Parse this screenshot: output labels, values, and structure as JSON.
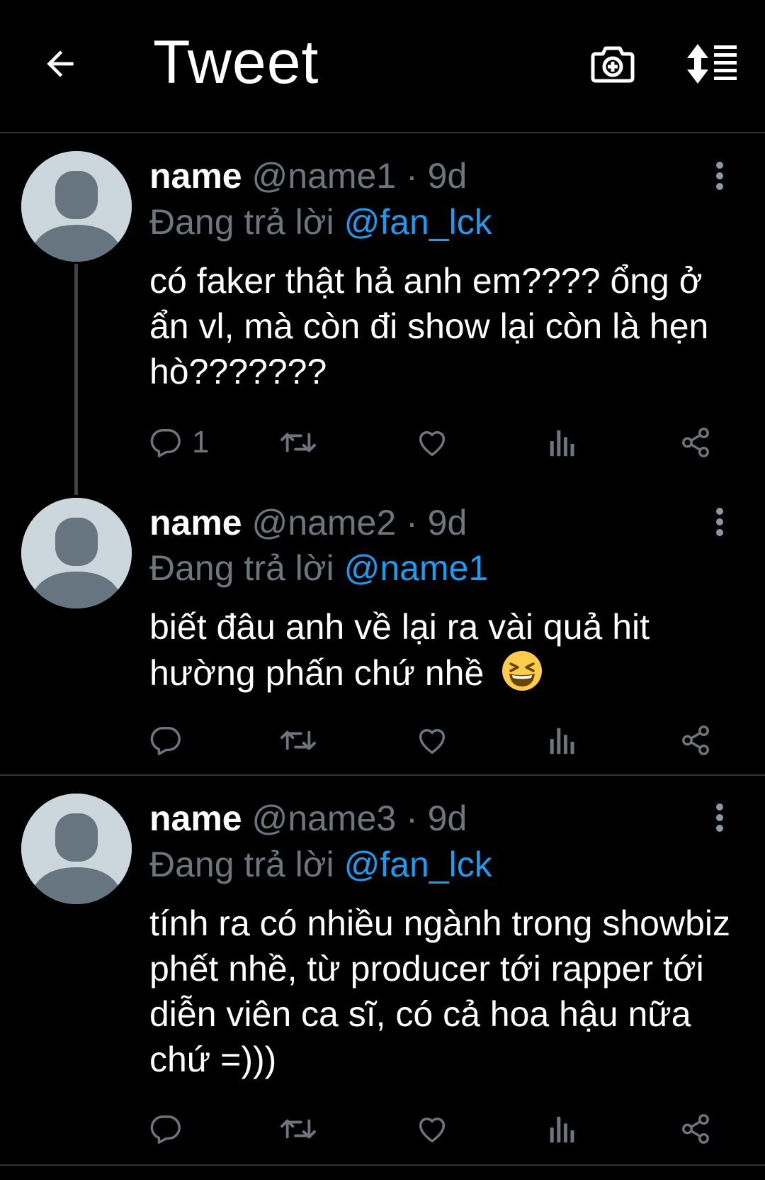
{
  "header": {
    "title": "Tweet",
    "back_icon": "arrow-left-icon",
    "camera_icon": "camera-plus-icon",
    "sort_icon": "sort-list-icon"
  },
  "colors": {
    "background": "#000000",
    "text_primary": "#ffffff",
    "text_secondary": "#6e767d",
    "accent": "#1d9bf0",
    "divider": "#2f3336"
  },
  "tweets": [
    {
      "name": "name",
      "handle": "@name1",
      "separator": "·",
      "time": "9d",
      "reply_prefix": "Đang trả lời",
      "reply_to": "@fan_lck",
      "text": "có faker thật hả anh em???? ổng ở ẩn vl, mà còn đi show lại còn là hẹn hò???????",
      "reply_count": "1"
    },
    {
      "name": "name",
      "handle": "@name2",
      "separator": "·",
      "time": "9d",
      "reply_prefix": "Đang trả lời",
      "reply_to": "@name1",
      "text": "biết đâu anh về lại ra vài quả hit hường phấn chứ nhề",
      "text_emoji": "laughing-face-emoji",
      "reply_count": ""
    },
    {
      "name": "name",
      "handle": "@name3",
      "separator": "·",
      "time": "9d",
      "reply_prefix": "Đang trả lời",
      "reply_to": "@fan_lck",
      "text": "tính ra có nhiều ngành trong showbiz phết nhề, từ producer tới rapper tới diễn viên ca sĩ, có cả hoa hậu nữa chứ =)))",
      "reply_count": ""
    }
  ]
}
